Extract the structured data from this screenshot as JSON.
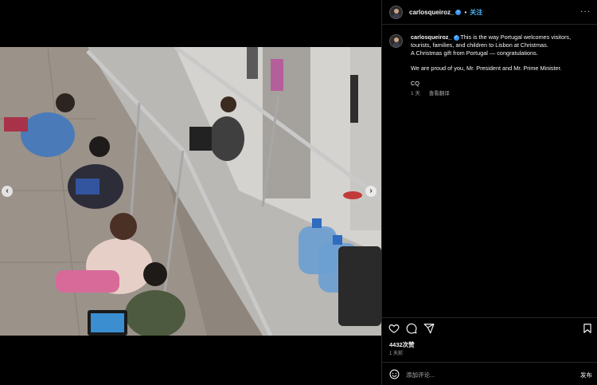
{
  "post": {
    "username": "carlosqueiroz_",
    "verified_mark": "✓",
    "dot": "•",
    "follow_label": "关注",
    "more_label": "···",
    "caption": {
      "line1": "This is the way Portugal welcomes visitors, tourists, families, and children to Lisbon at Christmas.",
      "line2": "A Christmas gift from Portugal — congratulations.",
      "line3": "We are proud of you, Mr. President and Mr. Prime Minister.",
      "line4": "CQ"
    },
    "meta": {
      "age": "1 天",
      "translate_label": "查看翻译"
    },
    "likes": "4432次赞",
    "timestamp": "1 天前",
    "comment_placeholder": "添加评论...",
    "post_label": "发布"
  },
  "media": {
    "prev_label": "‹",
    "next_label": "›"
  },
  "icons": [
    "heart-icon",
    "comment-icon",
    "share-icon",
    "bookmark-icon",
    "emoji-icon"
  ],
  "colors": {
    "accent": "#4cb5f9",
    "verified": "#3897f0",
    "background": "#000000",
    "muted": "#a8a8a8"
  }
}
